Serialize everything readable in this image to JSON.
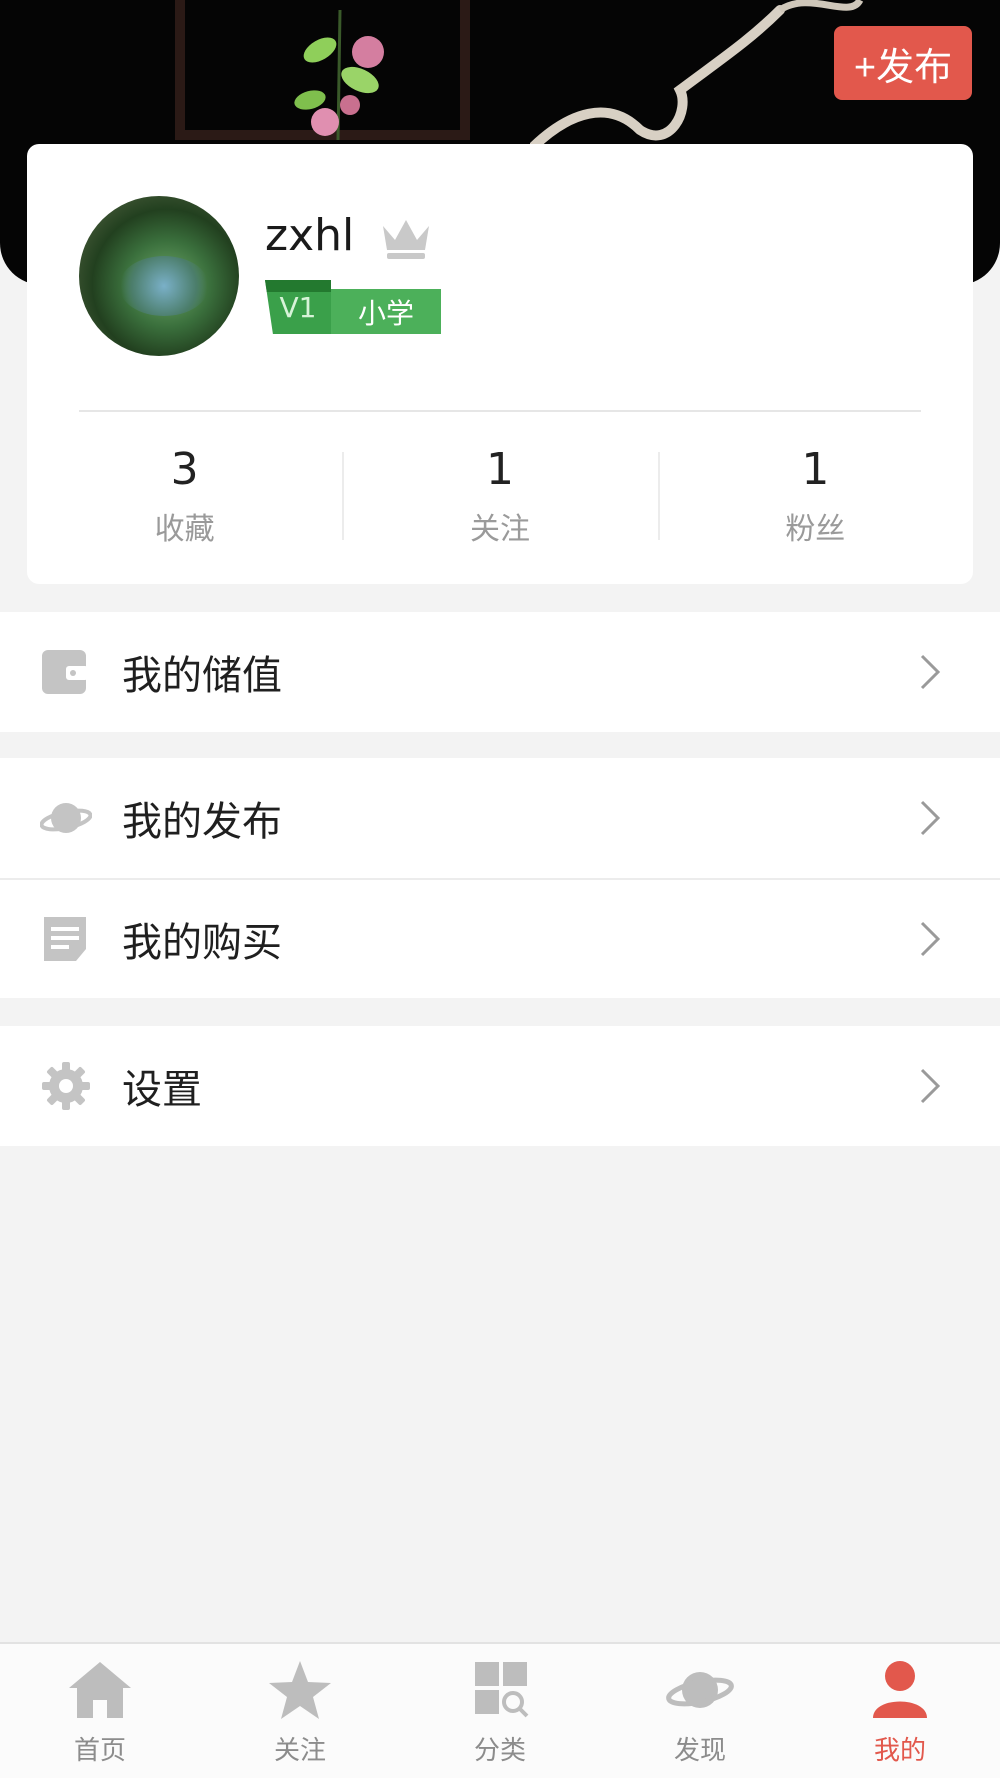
{
  "header": {
    "publish_label": "+发布"
  },
  "profile": {
    "username": "zxhl",
    "level_code": "V1",
    "level_name": "小学",
    "stats": [
      {
        "value": "3",
        "label": "收藏"
      },
      {
        "value": "1",
        "label": "关注"
      },
      {
        "value": "1",
        "label": "粉丝"
      }
    ]
  },
  "menu": {
    "wallet": "我的储值",
    "publish": "我的发布",
    "purchase": "我的购买",
    "settings": "设置"
  },
  "tabbar": {
    "items": [
      {
        "label": "首页",
        "icon": "home-icon"
      },
      {
        "label": "关注",
        "icon": "star-icon"
      },
      {
        "label": "分类",
        "icon": "category-icon"
      },
      {
        "label": "发现",
        "icon": "planet-icon"
      },
      {
        "label": "我的",
        "icon": "user-icon"
      }
    ],
    "active_index": 4
  },
  "colors": {
    "accent": "#e2584c",
    "level_green": "#4cb05a",
    "icon_gray": "#bdbdbd"
  }
}
